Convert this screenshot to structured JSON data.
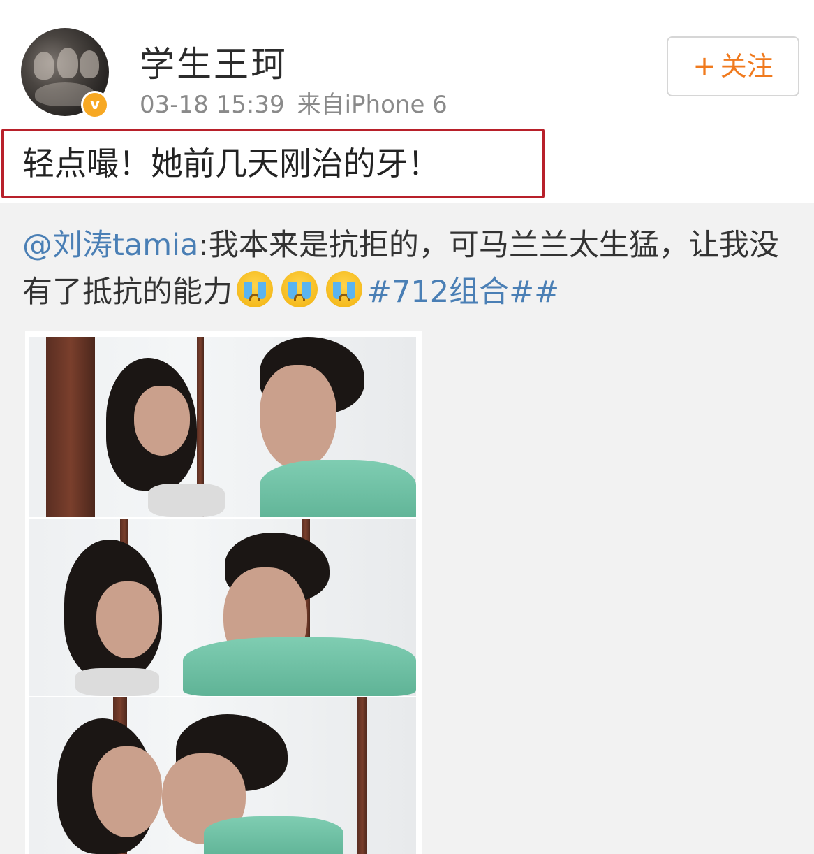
{
  "post": {
    "author": {
      "name": "学生王珂",
      "avatar_icon": "group-photo-avatar",
      "verified_badge": "v"
    },
    "timestamp": "03-18 15:39",
    "source": "来自iPhone 6",
    "follow_button": {
      "plus": "+",
      "label": "关注"
    },
    "text": "轻点嘬！她前几天刚治的牙！"
  },
  "repost": {
    "mention": "@刘涛tamia",
    "text": ":我本来是抗拒的，可马兰兰太生猛，让我没有了抵抗的能力",
    "emoji_icon": "crying-face-emoji",
    "hashtag": "#712组合##"
  },
  "colors": {
    "follow_accent": "#f07a1e",
    "highlight_border": "#b8202a",
    "link_blue": "#4a7fb5",
    "verified_badge": "#f7a823",
    "repost_background": "#f2f2f2"
  }
}
